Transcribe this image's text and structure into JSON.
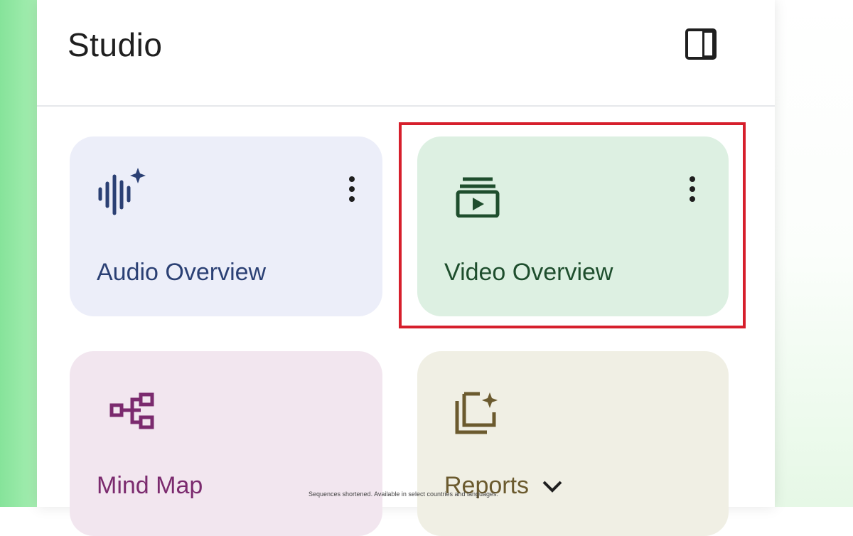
{
  "panel": {
    "title": "Studio",
    "collapse_icon": "side-panel-icon"
  },
  "cards": {
    "audio": {
      "label": "Audio Overview",
      "icon": "audio-wave-sparkle-icon",
      "color": "#2b4074"
    },
    "video": {
      "label": "Video Overview",
      "icon": "video-stack-play-icon",
      "color": "#1e4e2d"
    },
    "mind_map": {
      "label": "Mind Map",
      "icon": "mind-map-icon",
      "color": "#7b2a6e"
    },
    "reports": {
      "label": "Reports",
      "icon": "reports-sparkle-icon",
      "color": "#6b5a2e"
    }
  },
  "highlight_color": "#d61f2c",
  "footnote": "Sequences shortened. Available in select countries and languages."
}
